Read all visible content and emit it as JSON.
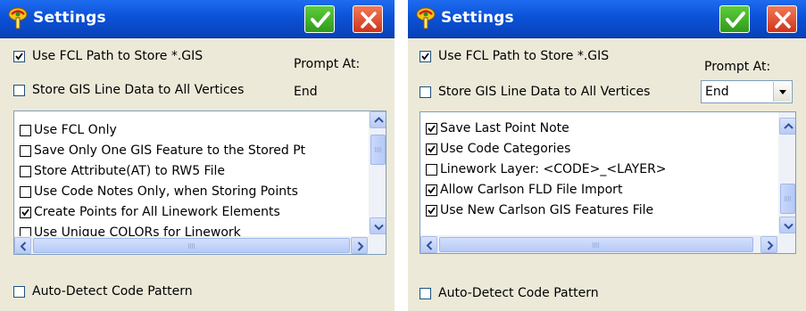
{
  "left": {
    "title": "Settings",
    "use_fcl_path_label": "Use FCL Path to Store *.GIS",
    "use_fcl_path_checked": true,
    "store_gis_line_label": "Store GIS Line Data to All Vertices",
    "store_gis_line_checked": false,
    "prompt_at_label": "Prompt At:",
    "prompt_at_value": "End",
    "list_items": [
      {
        "label": "Use FCL Only",
        "checked": false
      },
      {
        "label": "Save Only One GIS Feature to the Stored Pt",
        "checked": false
      },
      {
        "label": "Store Attribute(AT) to RW5 File",
        "checked": false
      },
      {
        "label": "Use Code Notes Only, when Storing Points",
        "checked": false
      },
      {
        "label": "Create Points for All Linework Elements",
        "checked": true
      },
      {
        "label": "Use Unique COLORs for Linework",
        "checked": false
      }
    ],
    "auto_detect_label": "Auto-Detect Code Pattern",
    "auto_detect_checked": false
  },
  "right": {
    "title": "Settings",
    "use_fcl_path_label": "Use FCL Path to Store *.GIS",
    "use_fcl_path_checked": true,
    "store_gis_line_label": "Store GIS Line Data to All Vertices",
    "store_gis_line_checked": false,
    "prompt_at_label": "Prompt At:",
    "prompt_at_value": "End",
    "list_items": [
      {
        "label": "Save Last Point Note",
        "checked": true
      },
      {
        "label": "Use Code Categories",
        "checked": true
      },
      {
        "label": "Linework Layer: <CODE>_<LAYER>",
        "checked": false
      },
      {
        "label": "Allow Carlson FLD File Import",
        "checked": true
      },
      {
        "label": "Use New Carlson GIS Features File",
        "checked": true
      }
    ],
    "auto_detect_label": "Auto-Detect Code Pattern",
    "auto_detect_checked": false
  },
  "colors": {
    "titlebar": "#0b52d8",
    "ok_button": "#2f9b1b",
    "close_button": "#d2331a",
    "panel_bg": "#ece9d8"
  },
  "icons": {
    "title": "settings-app-icon",
    "ok": "checkmark-icon",
    "close": "close-x-icon"
  }
}
